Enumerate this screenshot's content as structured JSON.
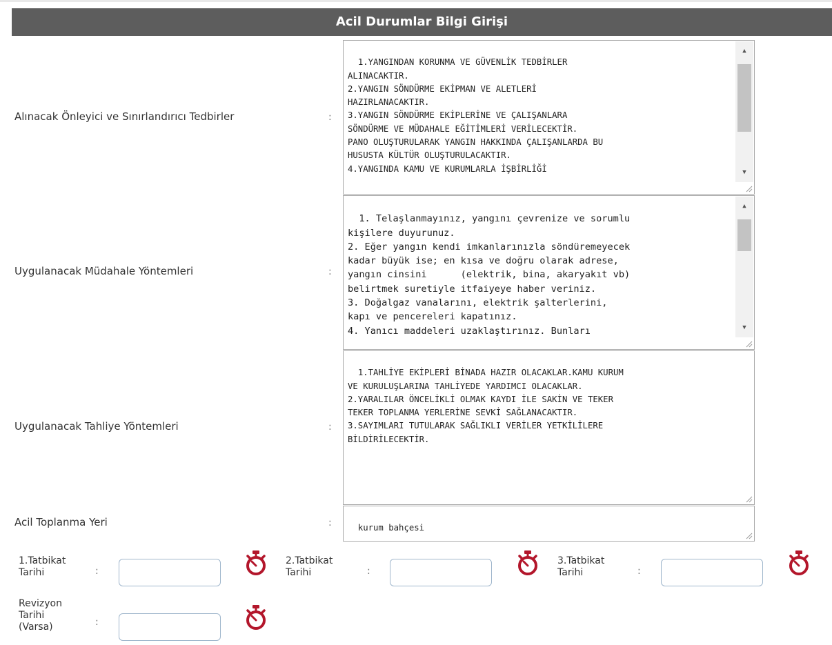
{
  "form": {
    "title": "Acil Durumlar Bilgi Girişi",
    "colon": ":",
    "fields": [
      {
        "label": "Alınacak Önleyici ve Sınırlandırıcı Tedbirler",
        "value": "1.YANGINDAN KORUNMA VE GÜVENLİK TEDBİRLER\nALINACAKTIR.\n2.YANGIN SÖNDÜRME EKİPMAN VE ALETLERİ\nHAZIRLANACAKTIR.\n3.YANGIN SÖNDÜRME EKİPLERİNE VE ÇALIŞANLARA\nSÖNDÜRME VE MÜDAHALE EĞİTİMLERİ VERİLECEKTİR.\nPANO OLUŞTURULARAK YANGIN HAKKINDA ÇALIŞANLARDA BU\nHUSUSTA KÜLTÜR OLUŞTURULACAKTIR.\n4.YANGINDA KAMU VE KURUMLARLA İŞBİRLİĞİ"
      },
      {
        "label": "Uygulanacak Müdahale Yöntemleri",
        "value": "1. Telaşlanmayınız, yangını çevrenize ve sorumlu\nkişilere duyurunuz.\n2. Eğer yangın kendi imkanlarınızla söndüremeyecek\nkadar büyük ise; en kısa ve doğru olarak adrese,\nyangın cinsini      (elektrik, bina, akaryakıt vb)\nbelirtmek suretiyle itfaiyeye haber veriniz.\n3. Doğalgaz vanalarını, elektrik şalterlerini,\nkapı ve pencereleri kapatınız.\n4. Yanıcı maddeleri uzaklaştırınız. Bunları"
      },
      {
        "label": "Uygulanacak Tahliye Yöntemleri",
        "value": "1.TAHLİYE EKİPLERİ BİNADA HAZIR OLACAKLAR.KAMU KURUM\nVE KURULUŞLARINA TAHLİYEDE YARDIMCI OLACAKLAR.\n2.YARALILAR ÖNCELİKLİ OLMAK KAYDI İLE SAKİN VE TEKER\nTEKER TOPLANMA YERLERİNE SEVKİ SAĞLANACAKTIR.\n3.SAYIMLARI TUTULARAK SAĞLIKLI VERİLER YETKİLİLERE\nBİLDİRİLECEKTİR."
      },
      {
        "label": "Acil Toplanma Yeri",
        "value": "kurum bahçesi"
      }
    ],
    "dates": [
      {
        "label_line1": "1.Tatbikat",
        "label_line2": "Tarihi",
        "value": "",
        "icon": "stopwatch-icon"
      },
      {
        "label_line1": "2.Tatbikat",
        "label_line2": "Tarihi",
        "value": "",
        "icon": "stopwatch-icon"
      },
      {
        "label_line1": "3.Tatbikat",
        "label_line2": "Tarihi",
        "value": "",
        "icon": "stopwatch-icon"
      },
      {
        "label_line1": "Revizyon",
        "label_line2": "Tarihi",
        "label_line3": "(Varsa)",
        "value": "",
        "icon": "stopwatch-icon"
      }
    ]
  },
  "colors": {
    "header_bg": "#5d5d5d",
    "icon_red": "#b3162b",
    "input_border": "#9fb6cc"
  }
}
